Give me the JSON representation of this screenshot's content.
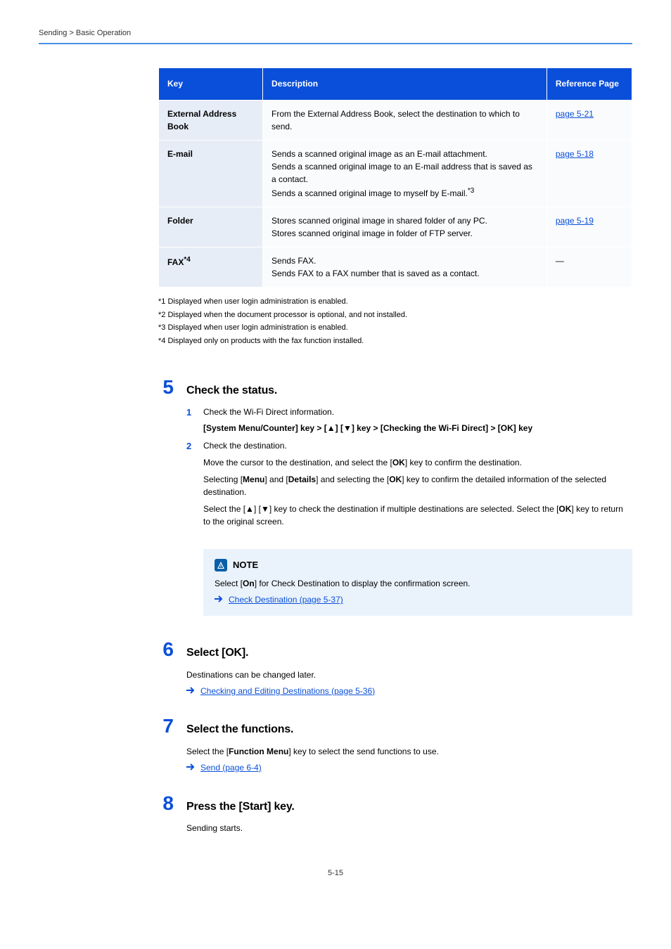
{
  "header": {
    "left": "Sending > Basic Operation",
    "right": ""
  },
  "table": {
    "headers": [
      "Key",
      "Description",
      "Reference Page"
    ],
    "rows": [
      {
        "key": "External Address Book",
        "desc": "From the External Address Book, select the destination to which to send.",
        "ref": "page 5-21"
      },
      {
        "key": "E-mail",
        "desc": "Sends a scanned original image as an E-mail attachment.\nSends a scanned original image to an E-mail address that is saved as a contact.\nSends a scanned original image to myself by E-mail.<sup>*3</sup>",
        "ref": "page 5-18"
      },
      {
        "key": "Folder",
        "desc": "Stores scanned original image in shared folder of any PC.\nStores scanned original image in folder of FTP server.",
        "ref": "page 5-19"
      },
      {
        "key": "FAX<sup>*4</sup>",
        "desc": "Sends FAX.\nSends FAX to a FAX number that is saved as a contact.",
        "ref": "―"
      }
    ]
  },
  "footnotes": [
    "*1  Displayed when user login administration is enabled.",
    "*2  Displayed when the document processor is optional, and not installed.",
    "*3  Displayed when user login administration is enabled.",
    "*4  Displayed only on products with the fax function installed."
  ],
  "steps": {
    "s5": {
      "title": "Check the status.",
      "sub1_label": "1",
      "sub1_intro": "Check the Wi-Fi Direct information.",
      "sub1_code": "[System Menu/Counter] key > [▲] [▼] key > [Checking the Wi-Fi Direct] > [OK] key",
      "sub2_label": "2",
      "sub2_intro": "Check the destination.",
      "sub2_p1": "Move the cursor to the destination, and select the [OK] key to confirm the destination.",
      "sub2_p2": "Selecting [Menu] and [Details] and selecting the [OK] key to confirm the detailed information of the selected destination.",
      "sub2_p3": "Select the [▲] [▼] key to check the destination if multiple destinations are selected. Select the [OK] key to return to the original screen."
    },
    "note": {
      "label": "NOTE",
      "body": "Select [On] for Check Destination to display the confirmation screen.",
      "link": "Check Destination (page 5-37)"
    },
    "s6": {
      "title": "Select [OK].",
      "body": "Destinations can be changed later.",
      "link": "Checking and Editing Destinations (page 5-36)"
    },
    "s7": {
      "title": "Select the functions.",
      "body": "Select the [Function Menu] key to select the send functions to use.",
      "link": "Send (page 6-4)"
    },
    "s8": {
      "title": "Press the [Start] key.",
      "body": "Sending starts."
    }
  },
  "pagenum": "5-15"
}
